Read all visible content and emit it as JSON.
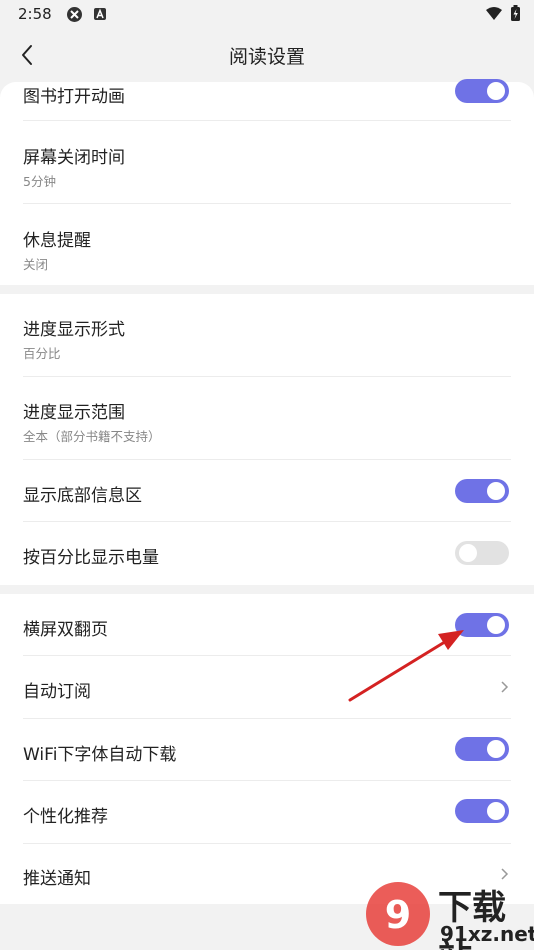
{
  "status_bar": {
    "time": "2:58"
  },
  "header": {
    "title": "阅读设置"
  },
  "rows": {
    "book_open_animation": {
      "title": "图书打开动画",
      "toggle": "on"
    },
    "screen_off_time": {
      "title": "屏幕关闭时间",
      "subtitle": "5分钟"
    },
    "rest_reminder": {
      "title": "休息提醒",
      "subtitle": "关闭"
    },
    "progress_format": {
      "title": "进度显示形式",
      "subtitle": "百分比"
    },
    "progress_range": {
      "title": "进度显示范围",
      "subtitle": "全本（部分书籍不支持）"
    },
    "show_bottom_info": {
      "title": "显示底部信息区",
      "toggle": "on"
    },
    "battery_percent": {
      "title": "按百分比显示电量",
      "toggle": "off"
    },
    "landscape_double_page": {
      "title": "横屏双翻页",
      "toggle": "on"
    },
    "auto_subscribe": {
      "title": "自动订阅"
    },
    "wifi_font_download": {
      "title": "WiFi下字体自动下载",
      "toggle": "on"
    },
    "personalized_recommend": {
      "title": "个性化推荐",
      "toggle": "on"
    },
    "push_notify": {
      "title": "推送通知"
    }
  },
  "watermark": {
    "cn": "下载站",
    "url": "91xz.net"
  },
  "colors": {
    "accent": "#6f72e6",
    "annotation_arrow": "#d42222",
    "background": "#f2f2f2"
  }
}
